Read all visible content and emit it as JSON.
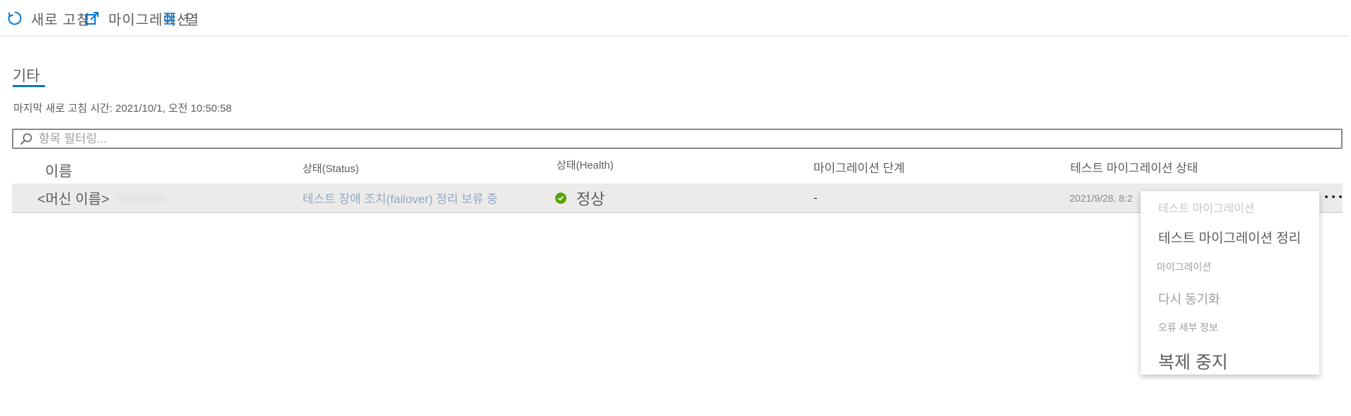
{
  "toolbar": {
    "refresh_label": "새로 고침",
    "migrate_label": "마이그레이션",
    "columns_label": "열"
  },
  "tab": {
    "label": "기타"
  },
  "last_refresh": {
    "label": "마지막 새로 고침 시간:",
    "value": "2021/10/1, 오전 10:50:58"
  },
  "filter": {
    "placeholder": "항목 필터링..."
  },
  "table": {
    "headers": {
      "name": "이름",
      "status": "상태(Status)",
      "health": "상태(Health)",
      "stage": "마이그레이션 단계",
      "test_status": "테스트 마이그레이션 상태"
    },
    "rows": [
      {
        "name": "<머신 이름>",
        "status": "테스트 장애 조치(failover) 정리 보류 중",
        "health": "정상",
        "stage": "-",
        "test_status": "2021/9/28, 8:2"
      }
    ]
  },
  "context_menu": {
    "items": [
      "테스트 마이그레이션",
      "테스트 마이그레이션 정리",
      "마이그레이션",
      "다시 동기화",
      "오류 세부 정보",
      "복제 중지"
    ]
  },
  "colors": {
    "accent": "#0078d4",
    "health_ok": "#57a300",
    "row_selected": "#edebe9"
  },
  "icons": {
    "refresh": "refresh-icon",
    "migrate": "migrate-icon",
    "columns": "columns-icon",
    "search": "search-icon",
    "more": "more-icon",
    "health": "check-circle-icon"
  }
}
